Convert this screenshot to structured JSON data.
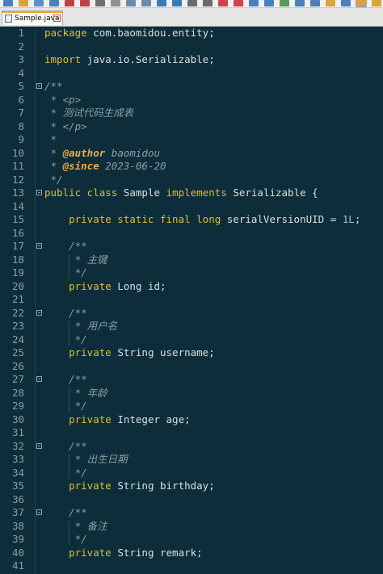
{
  "toolbar": {
    "icons": [
      "new-file-icon",
      "open-file-icon",
      "save-icon",
      "save-all-icon",
      "close-icon",
      "close-all-icon",
      "print-icon",
      "cut-icon",
      "copy-icon",
      "paste-icon",
      "undo-icon",
      "redo-icon",
      "find-icon",
      "replace-icon",
      "zoom-in-icon",
      "zoom-out-icon",
      "sync-v-icon",
      "sync-h-icon",
      "wrap-icon",
      "all-chars-icon",
      "indent-guide-icon",
      "udl-icon",
      "doc-map-icon",
      "function-list-icon",
      "folder-workspace-icon"
    ]
  },
  "tab": {
    "label": "Sample.java",
    "close": "×"
  },
  "editor": {
    "line_numbers": [
      "1",
      "2",
      "3",
      "4",
      "5",
      "6",
      "7",
      "8",
      "9",
      "10",
      "11",
      "12",
      "13",
      "14",
      "15",
      "16",
      "17",
      "18",
      "19",
      "20",
      "21",
      "22",
      "23",
      "24",
      "25",
      "26",
      "27",
      "28",
      "29",
      "30",
      "31",
      "32",
      "33",
      "34",
      "35",
      "36",
      "37",
      "38",
      "39",
      "40",
      "41"
    ],
    "lines": [
      {
        "tokens": [
          {
            "t": "package",
            "c": "kw"
          },
          {
            "t": " com.baomidou.entity;",
            "c": "pl"
          }
        ]
      },
      {
        "tokens": []
      },
      {
        "tokens": [
          {
            "t": "import",
            "c": "kw"
          },
          {
            "t": " java.io.Serializable;",
            "c": "pl"
          }
        ]
      },
      {
        "tokens": []
      },
      {
        "tokens": [
          {
            "t": "/**",
            "c": "cm"
          }
        ],
        "fold": true
      },
      {
        "tokens": [
          {
            "t": " * <p>",
            "c": "cm"
          }
        ]
      },
      {
        "tokens": [
          {
            "t": " * 测试代码生成表",
            "c": "cm"
          }
        ]
      },
      {
        "tokens": [
          {
            "t": " * </p>",
            "c": "cm"
          }
        ]
      },
      {
        "tokens": [
          {
            "t": " *",
            "c": "cm"
          }
        ]
      },
      {
        "tokens": [
          {
            "t": " * ",
            "c": "cm"
          },
          {
            "t": "@author",
            "c": "tag"
          },
          {
            "t": " baomidou",
            "c": "cm"
          }
        ]
      },
      {
        "tokens": [
          {
            "t": " * ",
            "c": "cm"
          },
          {
            "t": "@since",
            "c": "tag"
          },
          {
            "t": " 2023-06-20",
            "c": "cm"
          }
        ]
      },
      {
        "tokens": [
          {
            "t": " */",
            "c": "cm"
          }
        ]
      },
      {
        "tokens": [
          {
            "t": "public class",
            "c": "kw"
          },
          {
            "t": " Sample ",
            "c": "pl"
          },
          {
            "t": "implements",
            "c": "kw"
          },
          {
            "t": " Serializable {",
            "c": "pl"
          }
        ],
        "fold": true
      },
      {
        "tokens": []
      },
      {
        "tokens": [
          {
            "t": "    private static final long",
            "c": "kw"
          },
          {
            "t": " serialVersionUID = ",
            "c": "pl"
          },
          {
            "t": "1L",
            "c": "num"
          },
          {
            "t": ";",
            "c": "pl"
          }
        ]
      },
      {
        "tokens": []
      },
      {
        "tokens": [
          {
            "t": "    /**",
            "c": "cm"
          }
        ],
        "fold": true
      },
      {
        "tokens": [
          {
            "t": "     * 主键",
            "c": "cm"
          }
        ]
      },
      {
        "tokens": [
          {
            "t": "     */",
            "c": "cm"
          }
        ]
      },
      {
        "tokens": [
          {
            "t": "    private",
            "c": "kw"
          },
          {
            "t": " Long id;",
            "c": "pl"
          }
        ]
      },
      {
        "tokens": []
      },
      {
        "tokens": [
          {
            "t": "    /**",
            "c": "cm"
          }
        ],
        "fold": true
      },
      {
        "tokens": [
          {
            "t": "     * 用户名",
            "c": "cm"
          }
        ]
      },
      {
        "tokens": [
          {
            "t": "     */",
            "c": "cm"
          }
        ]
      },
      {
        "tokens": [
          {
            "t": "    private",
            "c": "kw"
          },
          {
            "t": " String username;",
            "c": "pl"
          }
        ]
      },
      {
        "tokens": []
      },
      {
        "tokens": [
          {
            "t": "    /**",
            "c": "cm"
          }
        ],
        "fold": true
      },
      {
        "tokens": [
          {
            "t": "     * 年龄",
            "c": "cm"
          }
        ]
      },
      {
        "tokens": [
          {
            "t": "     */",
            "c": "cm"
          }
        ]
      },
      {
        "tokens": [
          {
            "t": "    private",
            "c": "kw"
          },
          {
            "t": " Integer age;",
            "c": "pl"
          }
        ]
      },
      {
        "tokens": []
      },
      {
        "tokens": [
          {
            "t": "    /**",
            "c": "cm"
          }
        ],
        "fold": true
      },
      {
        "tokens": [
          {
            "t": "     * 出生日期",
            "c": "cm"
          }
        ]
      },
      {
        "tokens": [
          {
            "t": "     */",
            "c": "cm"
          }
        ]
      },
      {
        "tokens": [
          {
            "t": "    private",
            "c": "kw"
          },
          {
            "t": " String birthday;",
            "c": "pl"
          }
        ]
      },
      {
        "tokens": []
      },
      {
        "tokens": [
          {
            "t": "    /**",
            "c": "cm"
          }
        ],
        "fold": true
      },
      {
        "tokens": [
          {
            "t": "     * 备注",
            "c": "cm"
          }
        ]
      },
      {
        "tokens": [
          {
            "t": "     */",
            "c": "cm"
          }
        ]
      },
      {
        "tokens": [
          {
            "t": "    private",
            "c": "kw"
          },
          {
            "t": " String remark;",
            "c": "pl"
          }
        ]
      },
      {
        "tokens": []
      }
    ]
  },
  "colors": {
    "background": "#0c2d39",
    "keyword": "#ddbd3f",
    "plain": "#d8e0e3",
    "comment": "#8e9ea4",
    "number": "#7fd3c6",
    "doc_tag": "#f0a848",
    "tab_accent": "#f0a830"
  }
}
